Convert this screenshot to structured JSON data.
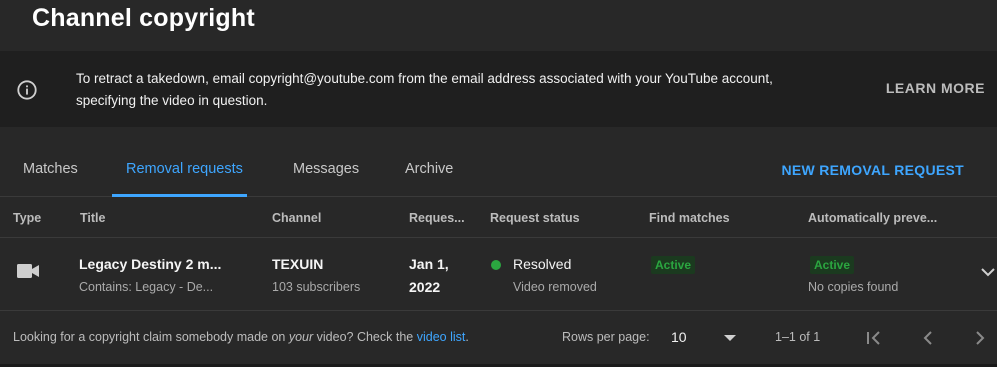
{
  "header": {
    "title": "Channel copyright"
  },
  "banner": {
    "line1": "To retract a takedown, email copyright@youtube.com from the email address associated with your YouTube account,",
    "line2": "specifying the video in question.",
    "learn_more": "LEARN MORE",
    "icon": "info-icon"
  },
  "tabs": [
    {
      "label": "Matches",
      "active": false
    },
    {
      "label": "Removal requests",
      "active": true
    },
    {
      "label": "Messages",
      "active": false
    },
    {
      "label": "Archive",
      "active": false
    }
  ],
  "actions": {
    "new_removal": "NEW REMOVAL REQUEST"
  },
  "table": {
    "columns": [
      "Type",
      "Title",
      "Channel",
      "Reques...",
      "Request status",
      "Find matches",
      "Automatically preve..."
    ],
    "rows": [
      {
        "type_icon": "video-camera-icon",
        "title": "Legacy Destiny 2 m...",
        "title_sub": "Contains: Legacy - De...",
        "channel": "TEXUIN",
        "channel_sub": "103 subscribers",
        "date_line1": "Jan 1,",
        "date_line2": "2022",
        "status": "Resolved",
        "status_sub": "Video removed",
        "find_matches": "Active",
        "auto_prevent": "Active",
        "auto_prevent_sub": "No copies found"
      }
    ]
  },
  "footer": {
    "text_before": "Looking for a copyright claim somebody made on ",
    "text_em": "your",
    "text_after": " video? Check the ",
    "link": "video list",
    "text_end": ".",
    "rows_label": "Rows per page:",
    "rows_value": "10",
    "range": "1–1 of 1"
  },
  "colors": {
    "accent": "#3ea6ff",
    "success": "#2ba640",
    "background": "#282828"
  }
}
